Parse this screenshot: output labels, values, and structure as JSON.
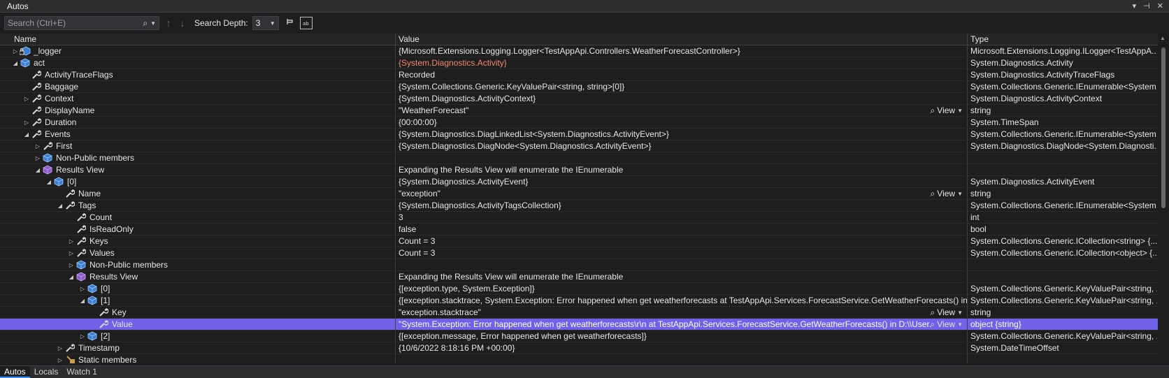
{
  "window": {
    "title": "Autos",
    "controls": [
      "▾",
      "⊣",
      "✕"
    ]
  },
  "toolbar": {
    "search_placeholder": "Search (Ctrl+E)",
    "depth_label": "Search Depth:",
    "depth_value": "3"
  },
  "columns": {
    "name": "Name",
    "value": "Value",
    "type": "Type"
  },
  "rows": [
    {
      "depth": 0,
      "expander": "right",
      "icon": "field-lock",
      "name": "_logger",
      "value": "{Microsoft.Extensions.Logging.Logger<TestAppApi.Controllers.WeatherForecastController>}",
      "type": "Microsoft.Extensions.Logging.ILogger<TestAppA...",
      "view": false,
      "red": false
    },
    {
      "depth": 0,
      "expander": "down",
      "icon": "field",
      "name": "act",
      "value": "{System.Diagnostics.Activity}",
      "type": "System.Diagnostics.Activity",
      "view": false,
      "red": true
    },
    {
      "depth": 1,
      "expander": "none",
      "icon": "wrench",
      "name": "ActivityTraceFlags",
      "value": "Recorded",
      "type": "System.Diagnostics.ActivityTraceFlags",
      "view": false,
      "red": false
    },
    {
      "depth": 1,
      "expander": "none",
      "icon": "wrench",
      "name": "Baggage",
      "value": "{System.Collections.Generic.KeyValuePair<string, string>[0]}",
      "type": "System.Collections.Generic.IEnumerable<System...",
      "view": false,
      "red": false
    },
    {
      "depth": 1,
      "expander": "right",
      "icon": "wrench",
      "name": "Context",
      "value": "{System.Diagnostics.ActivityContext}",
      "type": "System.Diagnostics.ActivityContext",
      "view": false,
      "red": false
    },
    {
      "depth": 1,
      "expander": "none",
      "icon": "wrench",
      "name": "DisplayName",
      "value": "\"WeatherForecast\"",
      "type": "string",
      "view": true,
      "red": false
    },
    {
      "depth": 1,
      "expander": "right",
      "icon": "wrench",
      "name": "Duration",
      "value": "{00:00:00}",
      "type": "System.TimeSpan",
      "view": false,
      "red": false
    },
    {
      "depth": 1,
      "expander": "down",
      "icon": "wrench",
      "name": "Events",
      "value": "{System.Diagnostics.DiagLinkedList<System.Diagnostics.ActivityEvent>}",
      "type": "System.Collections.Generic.IEnumerable<System...",
      "view": false,
      "red": false
    },
    {
      "depth": 2,
      "expander": "right",
      "icon": "wrench",
      "name": "First",
      "value": "{System.Diagnostics.DiagNode<System.Diagnostics.ActivityEvent>}",
      "type": "System.Diagnostics.DiagNode<System.Diagnosti...",
      "view": false,
      "red": false
    },
    {
      "depth": 2,
      "expander": "right",
      "icon": "field",
      "name": "Non-Public members",
      "value": "",
      "type": "",
      "view": false,
      "red": false
    },
    {
      "depth": 2,
      "expander": "down",
      "icon": "cube",
      "name": "Results View",
      "value": "Expanding the Results View will enumerate the IEnumerable",
      "type": "",
      "view": false,
      "red": false
    },
    {
      "depth": 3,
      "expander": "down",
      "icon": "field",
      "name": "[0]",
      "value": "{System.Diagnostics.ActivityEvent}",
      "type": "System.Diagnostics.ActivityEvent",
      "view": false,
      "red": false
    },
    {
      "depth": 4,
      "expander": "none",
      "icon": "wrench",
      "name": "Name",
      "value": "\"exception\"",
      "type": "string",
      "view": true,
      "red": false
    },
    {
      "depth": 4,
      "expander": "down",
      "icon": "wrench",
      "name": "Tags",
      "value": "{System.Diagnostics.ActivityTagsCollection}",
      "type": "System.Collections.Generic.IEnumerable<System...",
      "view": false,
      "red": false
    },
    {
      "depth": 5,
      "expander": "none",
      "icon": "wrench",
      "name": "Count",
      "value": "3",
      "type": "int",
      "view": false,
      "red": false
    },
    {
      "depth": 5,
      "expander": "none",
      "icon": "wrench",
      "name": "IsReadOnly",
      "value": "false",
      "type": "bool",
      "view": false,
      "red": false
    },
    {
      "depth": 5,
      "expander": "right",
      "icon": "wrench",
      "name": "Keys",
      "value": "Count = 3",
      "type": "System.Collections.Generic.ICollection<string> {...",
      "view": false,
      "red": false
    },
    {
      "depth": 5,
      "expander": "right",
      "icon": "wrench",
      "name": "Values",
      "value": "Count = 3",
      "type": "System.Collections.Generic.ICollection<object> {...",
      "view": false,
      "red": false
    },
    {
      "depth": 5,
      "expander": "right",
      "icon": "field",
      "name": "Non-Public members",
      "value": "",
      "type": "",
      "view": false,
      "red": false
    },
    {
      "depth": 5,
      "expander": "down",
      "icon": "cube",
      "name": "Results View",
      "value": "Expanding the Results View will enumerate the IEnumerable",
      "type": "",
      "view": false,
      "red": false
    },
    {
      "depth": 6,
      "expander": "right",
      "icon": "field",
      "name": "[0]",
      "value": "{[exception.type, System.Exception]}",
      "type": "System.Collections.Generic.KeyValuePair<string, ...",
      "view": false,
      "red": false
    },
    {
      "depth": 6,
      "expander": "down",
      "icon": "field",
      "name": "[1]",
      "value": "{[exception.stacktrace, System.Exception: Error happened when get weatherforecasts   at TestAppApi.Services.ForecastService.GetWeatherForecasts() in D...",
      "type": "System.Collections.Generic.KeyValuePair<string, ...",
      "view": false,
      "red": false
    },
    {
      "depth": 7,
      "expander": "none",
      "icon": "wrench",
      "name": "Key",
      "value": "\"exception.stacktrace\"",
      "type": "string",
      "view": true,
      "red": false
    },
    {
      "depth": 7,
      "expander": "none",
      "icon": "wrench",
      "name": "Value",
      "value": "\"System.Exception: Error happened when get weatherforecasts\\r\\n   at TestAppApi.Services.ForecastService.GetWeatherForecasts() in D:\\\\User...",
      "type": "object {string}",
      "view": true,
      "red": false,
      "selected": true
    },
    {
      "depth": 6,
      "expander": "right",
      "icon": "field",
      "name": "[2]",
      "value": "{[exception.message, Error happened when get weatherforecasts]}",
      "type": "System.Collections.Generic.KeyValuePair<string, ...",
      "view": false,
      "red": false
    },
    {
      "depth": 4,
      "expander": "right",
      "icon": "wrench",
      "name": "Timestamp",
      "value": "{10/6/2022 8:18:16 PM +00:00}",
      "type": "System.DateTimeOffset",
      "view": false,
      "red": false
    },
    {
      "depth": 4,
      "expander": "right",
      "icon": "static",
      "name": "Static members",
      "value": "",
      "type": "",
      "view": false,
      "red": false
    }
  ],
  "view_label": "View",
  "tabs": [
    {
      "label": "Autos",
      "active": true
    },
    {
      "label": "Locals",
      "active": false
    },
    {
      "label": "Watch 1",
      "active": false
    }
  ]
}
